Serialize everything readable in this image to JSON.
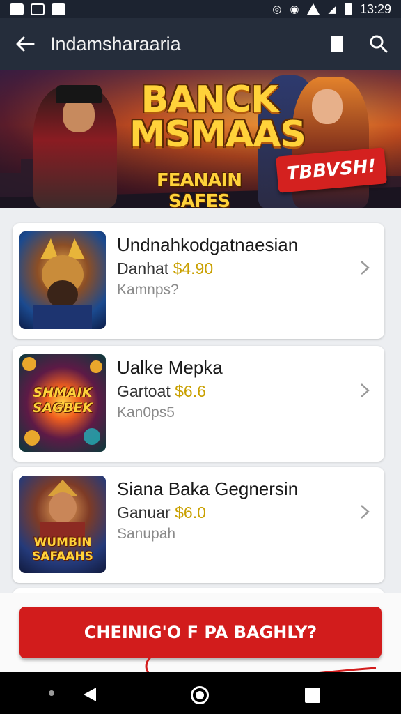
{
  "status_bar": {
    "time": "13:29",
    "left_icons": [
      "notification-icon",
      "image-icon",
      "app-icon"
    ],
    "right_icons": [
      "alarm-icon",
      "alarm-clock-icon",
      "wifi-icon",
      "signal-icon",
      "battery-icon"
    ]
  },
  "app_bar": {
    "title": "Indamsharaaria",
    "back_icon": "arrow-left-icon",
    "bookmark_icon": "bookmark-icon",
    "search_icon": "search-icon"
  },
  "banner": {
    "title_line1": "BANCK",
    "title_line2": "MSMAAS",
    "subtitle": "FEANAIN SAFES",
    "tag": "TBBVSH!"
  },
  "list": {
    "items": [
      {
        "title": "Undnahkodgatnaesian",
        "line2_label": "Danhat",
        "price": "$4.90",
        "line3": "Kamnps?",
        "thumb_label": ""
      },
      {
        "title": "Ualke Mepka",
        "line2_label": "Gartoat",
        "price": "$6.6",
        "line3": "Kan0ps5",
        "thumb_label": "SHMAIK SAGBEK"
      },
      {
        "title": "Siana Baka Gegnersin",
        "line2_label": "Ganuar",
        "price": "$6.0",
        "line3": "Sanupah",
        "thumb_label": "WUMBIN SAFAAHS"
      }
    ]
  },
  "cta": {
    "label": "CHEINIG'O F PA BAGHLY?"
  },
  "nav_bar": {
    "icons": [
      "dot-icon",
      "back-triangle-icon",
      "home-circle-icon",
      "recents-square-icon"
    ]
  },
  "colors": {
    "status_bar": "#1c2330",
    "app_bar": "#252d3b",
    "cta": "#d21c1c",
    "price": "#c9a000",
    "background": "#eceef1"
  }
}
